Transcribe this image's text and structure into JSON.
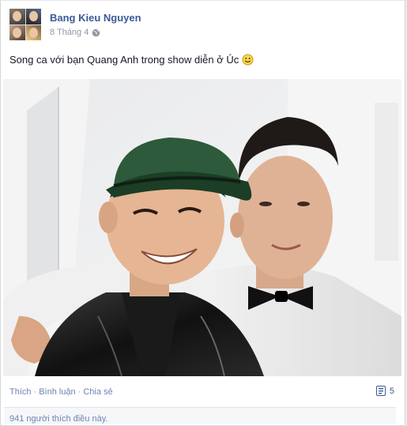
{
  "post": {
    "author": "Bang Kieu Nguyen",
    "date": "8 Tháng 4",
    "privacy_icon": "globe-icon",
    "text": "Song ca với bạn Quang Anh trong show diễn ở Úc",
    "emoji_icon": "smiley-icon"
  },
  "actions": {
    "like": "Thích",
    "comment": "Bình luận",
    "share": "Chia sẻ",
    "separator": "·",
    "share_count": "5",
    "share_count_icon": "share-count-icon"
  },
  "likes": {
    "text": "941 người thích điều này."
  },
  "colors": {
    "link": "#3b5998",
    "action_link": "#6d84b4",
    "meta": "#9197a3",
    "text": "#141823"
  }
}
